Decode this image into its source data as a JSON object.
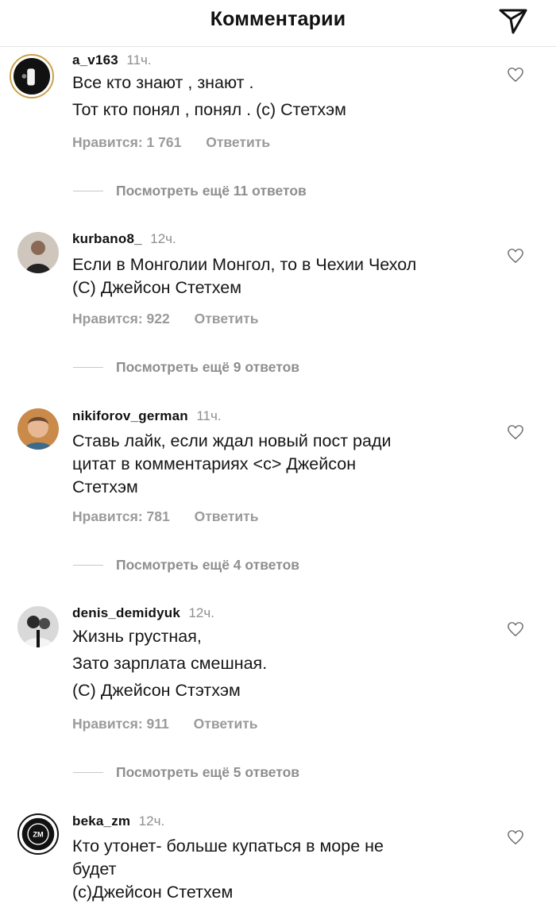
{
  "header": {
    "title": "Комментарии",
    "send_icon": "send-paper-plane-icon"
  },
  "comments": [
    {
      "username": "a_v163",
      "time": "11ч.",
      "lines": [
        "Все кто знают , знают .",
        "Тот кто понял , понял . (с) Стетхэм"
      ],
      "likes": "Нравится: 1 761",
      "reply": "Ответить",
      "replies": "Посмотреть ещё 11 ответов"
    },
    {
      "username": "kurbano8_",
      "time": "12ч.",
      "lines": [
        "Если в Монголии Монгол, то в Чехии Чехол",
        "(С) Джейсон Стетхем"
      ],
      "likes": "Нравится: 922",
      "reply": "Ответить",
      "replies": "Посмотреть ещё 9 ответов"
    },
    {
      "username": "nikiforov_german",
      "time": "11ч.",
      "lines": [
        "Ставь лайк, если ждал новый пост ради",
        "цитат в комментариях <с> Джейсон",
        "Стетхэм"
      ],
      "likes": "Нравится: 781",
      "reply": "Ответить",
      "replies": "Посмотреть ещё 4 ответов"
    },
    {
      "username": "denis_demidyuk",
      "time": "12ч.",
      "lines": [
        "Жизнь грустная,",
        "Зато зарплата смешная.",
        "(С) Джейсон Стэтхэм"
      ],
      "likes": "Нравится: 911",
      "reply": "Ответить",
      "replies": "Посмотреть ещё 5 ответов"
    },
    {
      "username": "beka_zm",
      "time": "12ч.",
      "lines": [
        "Кто утонет- больше купаться в море не",
        "будет",
        "(с)Джейсон Стетхем"
      ],
      "avatar_badge": "ZM"
    }
  ]
}
